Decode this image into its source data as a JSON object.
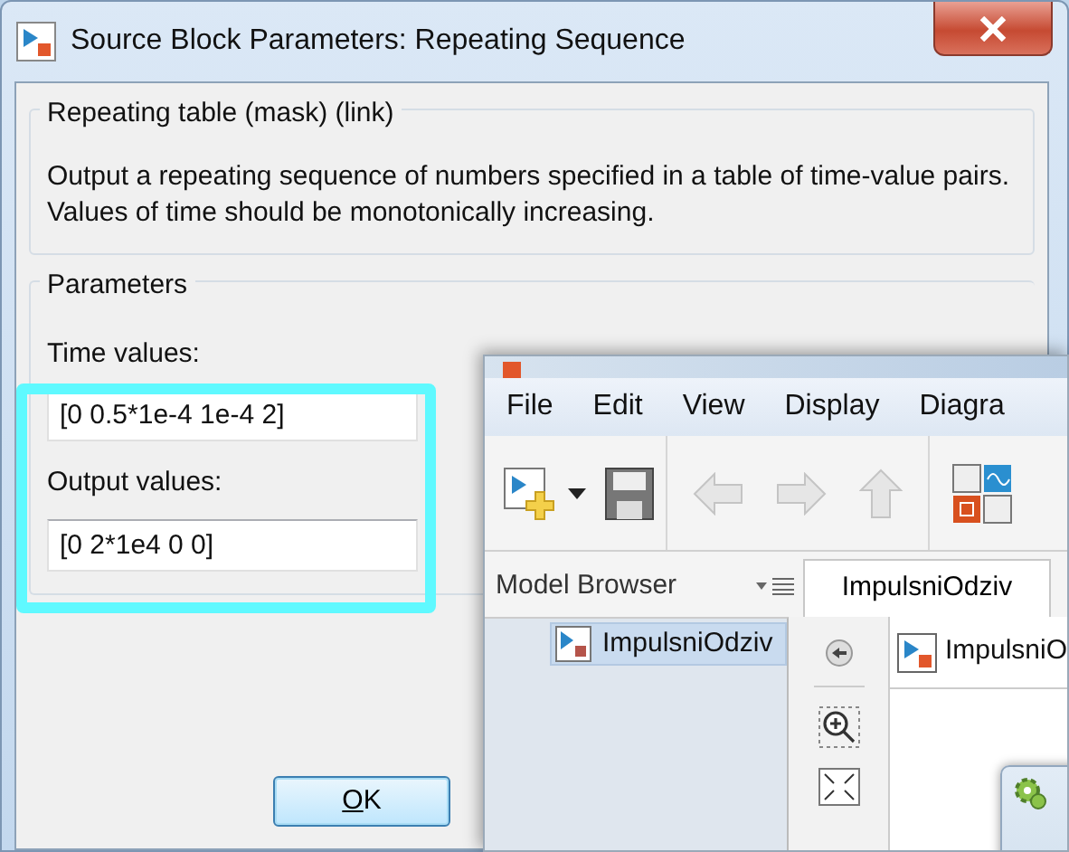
{
  "dialog": {
    "title": "Source Block Parameters: Repeating Sequence",
    "mask_group": {
      "title": "Repeating table (mask) (link)",
      "description": "Output a repeating sequence of numbers specified in a table of time-value pairs. Values of time should be monotonically increasing."
    },
    "parameters_group": {
      "title": "Parameters",
      "fields": [
        {
          "label": "Time values:",
          "value": "[0 0.5*1e-4 1e-4 2]"
        },
        {
          "label": "Output values:",
          "value": "[0 2*1e4 0 0]"
        }
      ]
    },
    "buttons": [
      {
        "label": "OK"
      }
    ]
  },
  "editor": {
    "menu": [
      "File",
      "Edit",
      "View",
      "Display",
      "Diagra"
    ],
    "model_browser": {
      "title": "Model Browser",
      "tree": [
        {
          "label": "ImpulsniOdziv",
          "selected": true
        }
      ]
    },
    "tabs": [
      {
        "label": "ImpulsniOdziv",
        "selected": true
      }
    ],
    "address": "ImpulsniO"
  }
}
